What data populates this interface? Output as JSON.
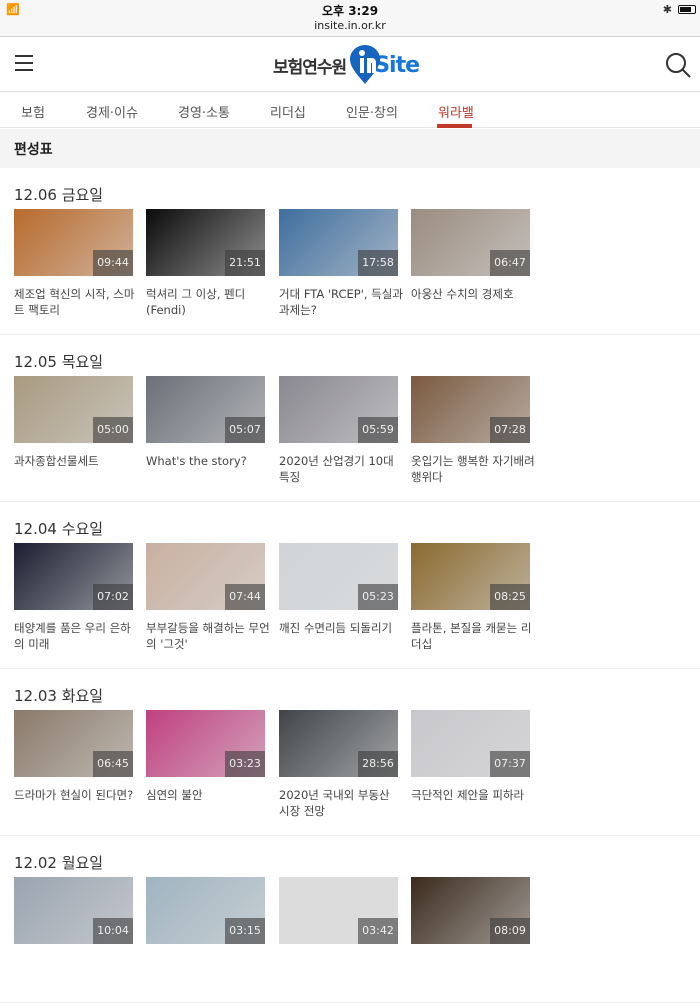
{
  "status": {
    "time": "오후 3:29",
    "url": "insite.in.or.kr"
  },
  "header": {
    "logo_ko": "보험연수원",
    "logo_en": "Site",
    "logo_pin": "in"
  },
  "nav": [
    {
      "label": "보험"
    },
    {
      "label": "경제·이슈"
    },
    {
      "label": "경영·소통"
    },
    {
      "label": "리더십"
    },
    {
      "label": "인문·창의"
    },
    {
      "label": "워라밸",
      "active": true
    }
  ],
  "schedule_label": "편성표",
  "sections": [
    {
      "date": "12.06 금요일",
      "items": [
        {
          "title": "제조업 혁신의 시작, 스마트 팩토리",
          "duration": "09:44",
          "color": "#b86a2c"
        },
        {
          "title": "럭셔리 그 이상, 펜디 (Fendi)",
          "duration": "21:51",
          "color": "#0a0a0a"
        },
        {
          "title": "거대 FTA 'RCEP', 득실과 과제는?",
          "duration": "17:58",
          "color": "#3f6e9e"
        },
        {
          "title": "아웅산 수치의 경제호",
          "duration": "06:47",
          "color": "#9a8c80"
        }
      ]
    },
    {
      "date": "12.05 목요일",
      "items": [
        {
          "title": "과자종합선물세트",
          "duration": "05:00",
          "color": "#a89a80"
        },
        {
          "title": "What's the story?",
          "duration": "05:07",
          "color": "#6b6f78"
        },
        {
          "title": "2020년 산업경기 10대 특징",
          "duration": "05:59",
          "color": "#8a8890"
        },
        {
          "title": "옷입기는 행복한 자기배려 행위다",
          "duration": "07:28",
          "color": "#7a5a40"
        }
      ]
    },
    {
      "date": "12.04 수요일",
      "items": [
        {
          "title": "태양계를 품은 우리 은하의 미래",
          "duration": "07:02",
          "color": "#1a1e30"
        },
        {
          "title": "부부갈등을 해결하는 무언의 '그것'",
          "duration": "07:44",
          "color": "#c8b0a0"
        },
        {
          "title": "깨진 수면리듬 되돌리기",
          "duration": "05:23",
          "color": "#d0d4d8"
        },
        {
          "title": "플라톤, 본질을 캐묻는 리더십",
          "duration": "08:25",
          "color": "#8a6a30"
        }
      ]
    },
    {
      "date": "12.03 화요일",
      "items": [
        {
          "title": "드라마가 현실이 된다면?",
          "duration": "06:45",
          "color": "#8a7a6a"
        },
        {
          "title": "심연의 불안",
          "duration": "03:23",
          "color": "#c04080"
        },
        {
          "title": "2020년 국내외 부동산 시장 전망",
          "duration": "28:56",
          "color": "#404448"
        },
        {
          "title": "극단적인 제안을 피하라",
          "duration": "07:37",
          "color": "#c8c8cc"
        }
      ]
    },
    {
      "date": "12.02 월요일",
      "items": [
        {
          "title": "",
          "duration": "10:04",
          "color": "#9aa4b0"
        },
        {
          "title": "",
          "duration": "03:15",
          "color": "#a0b4c0"
        },
        {
          "title": "",
          "duration": "03:42",
          "color": "#dcdcdc"
        },
        {
          "title": "",
          "duration": "08:09",
          "color": "#3a2a1c"
        }
      ]
    }
  ]
}
